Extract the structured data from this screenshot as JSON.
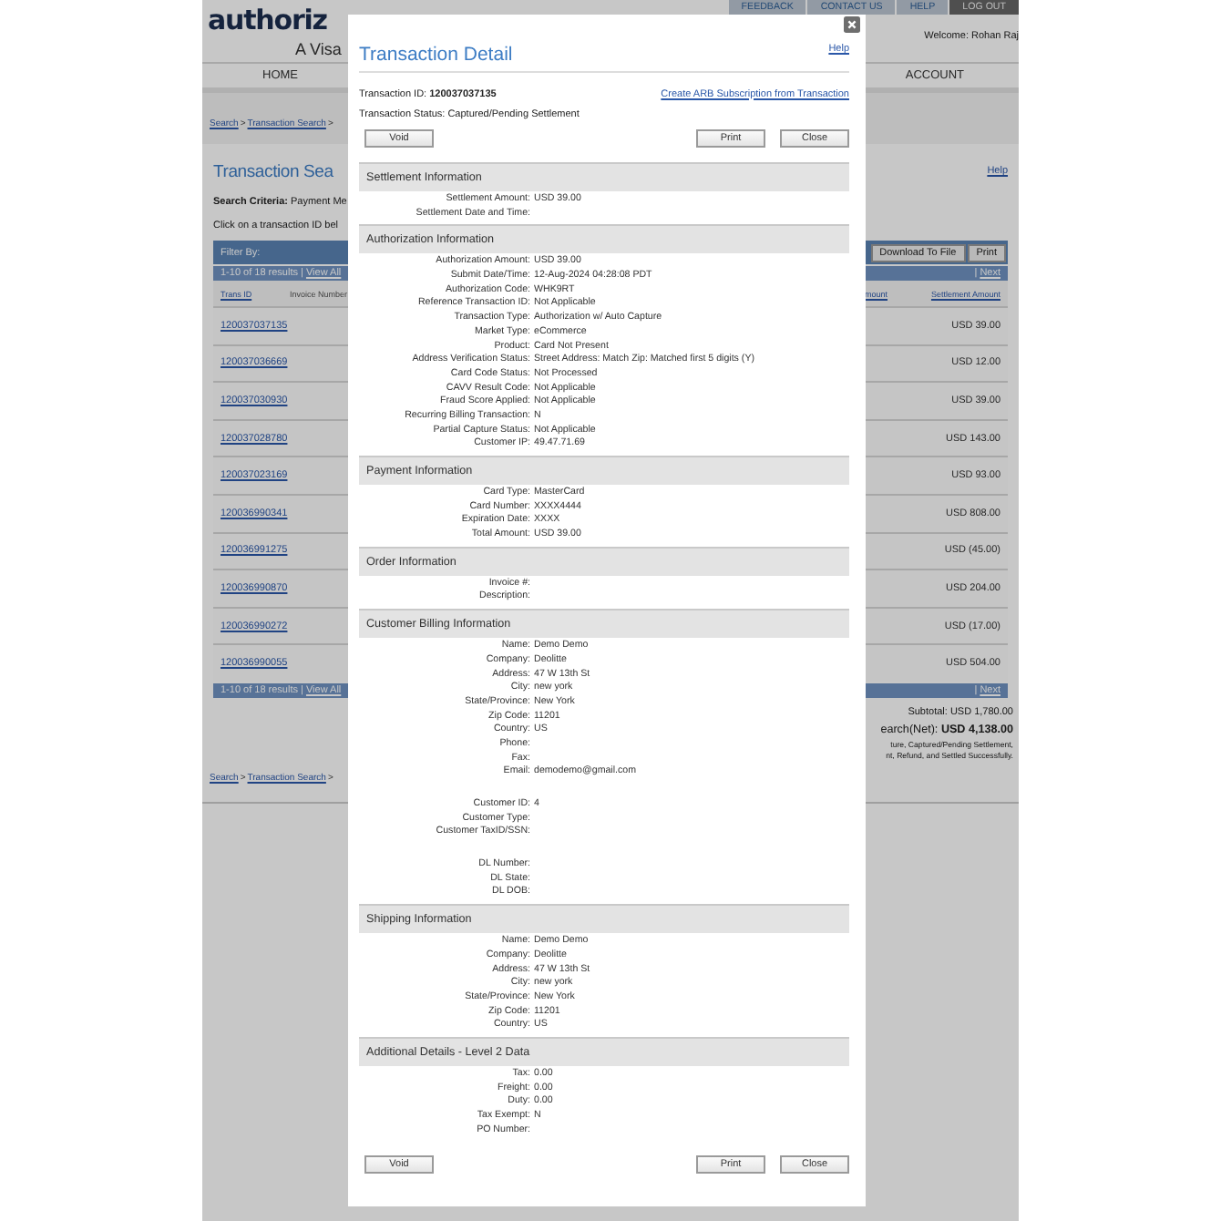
{
  "header": {
    "logo": "authoriz",
    "tagline": "A Visa",
    "top_links": [
      {
        "label": "FEEDBACK",
        "selected": false
      },
      {
        "label": "CONTACT US",
        "selected": false
      },
      {
        "label": "HELP",
        "selected": false
      },
      {
        "label": "LOG OUT",
        "selected": true
      }
    ],
    "welcome": "Welcome: Rohan Raj",
    "nav": [
      "HOME",
      "ACCOUNT"
    ]
  },
  "page": {
    "breadcrumb": [
      {
        "text": "Search",
        "kind": "link"
      },
      {
        "text": ">",
        "kind": "separator"
      },
      {
        "text": "Transaction Search",
        "kind": "link"
      },
      {
        "text": ">",
        "kind": "separator"
      }
    ],
    "title": "Transaction Sea",
    "help": "Help",
    "search_criteria": "**Search Criteria:** Payment Me",
    "instruction": "Click on a transaction ID bel",
    "filter_label": "Filter By:",
    "toolbar_buttons": [
      "Download To File",
      "Print"
    ],
    "pager": {
      "range": "1-10 of 18 results |",
      "view_all": "View All",
      "separator": "|",
      "next": "Next"
    },
    "columns": [
      "Trans ID",
      "Invoice Number",
      "mount",
      "Settlement Amount"
    ],
    "rows": [
      {
        "trans_id": "120037037135",
        "amount": "USD 39.00"
      },
      {
        "trans_id": "120037036669",
        "amount": "USD 12.00"
      },
      {
        "trans_id": "120037030930",
        "amount": "USD 39.00"
      },
      {
        "trans_id": "120037028780",
        "amount": "USD 143.00"
      },
      {
        "trans_id": "120037023169",
        "amount": "USD 93.00"
      },
      {
        "trans_id": "120036990341",
        "amount": "USD 808.00"
      },
      {
        "trans_id": "120036991275",
        "amount": "USD (45.00)"
      },
      {
        "trans_id": "120036990870",
        "amount": "USD 204.00"
      },
      {
        "trans_id": "120036990272",
        "amount": "USD (17.00)"
      },
      {
        "trans_id": "120036990055",
        "amount": "USD 504.00"
      }
    ],
    "pager_bottom": {
      "range": "1-10 of 18 results |",
      "view_all": "View All",
      "separator": "|",
      "next": "Next"
    },
    "subtotal": "Subtotal: USD 1,780.00",
    "net_total": "earch(Net): **USD 4,138.00**",
    "notes": [
      "ture, Captured/Pending Settlement,",
      "nt, Refund, and Settled Successfully."
    ],
    "breadcrumb_bottom": [
      {
        "text": "Search",
        "kind": "link"
      },
      {
        "text": ">",
        "kind": "separator"
      },
      {
        "text": "Transaction Search",
        "kind": "link"
      },
      {
        "text": ">",
        "kind": "separator"
      }
    ]
  },
  "modal": {
    "title": "Transaction Detail",
    "help": "Help",
    "transaction_id": "Transaction ID: **120037037135**",
    "arb_link": "Create ARB Subscription from Transaction",
    "status": "Transaction Status: Captured/Pending Settlement",
    "buttons_top": {
      "left": [
        "Void"
      ],
      "right": [
        "Print",
        "Close"
      ]
    },
    "buttons_bottom": {
      "left": [
        "Void"
      ],
      "right": [
        "Print",
        "Close"
      ]
    },
    "sections": [
      {
        "title": "Settlement Information",
        "groups": [
          [
            {
              "label": "Settlement Amount:",
              "value": "USD 39.00"
            },
            {
              "label": "Settlement Date and Time:"
            }
          ]
        ]
      },
      {
        "title": "Authorization Information",
        "groups": [
          [
            {
              "label": "Authorization Amount:",
              "value": "USD 39.00"
            },
            {
              "label": "Submit Date/Time:",
              "value": "12-Aug-2024 04:28:08 PDT"
            },
            {
              "label": "Authorization Code:",
              "value": "WHK9RT"
            },
            {
              "label": "Reference Transaction ID:",
              "value": "Not Applicable"
            },
            {
              "label": "Transaction Type:",
              "value": "Authorization w/ Auto Capture"
            },
            {
              "label": "Market Type:",
              "value": "eCommerce"
            },
            {
              "label": "Product:",
              "value": "Card Not Present"
            },
            {
              "label": "Address Verification Status:",
              "value": "Street Address: Match Zip: Matched first 5 digits (Y)"
            },
            {
              "label": "Card Code Status:",
              "value": "Not Processed"
            },
            {
              "label": "CAVV Result Code:",
              "value": "Not Applicable"
            },
            {
              "label": "Fraud Score Applied:",
              "value": "Not Applicable"
            },
            {
              "label": "Recurring Billing Transaction:",
              "value": "N"
            },
            {
              "label": "Partial Capture Status:",
              "value": "Not Applicable"
            },
            {
              "label": "Customer IP:",
              "value": "49.47.71.69"
            }
          ]
        ]
      },
      {
        "title": "Payment Information",
        "groups": [
          [
            {
              "label": "Card Type:",
              "value": "MasterCard"
            },
            {
              "label": "Card Number:",
              "value": "XXXX4444"
            },
            {
              "label": "Expiration Date:",
              "value": "XXXX"
            },
            {
              "label": "Total Amount:",
              "value": "USD 39.00"
            }
          ]
        ]
      },
      {
        "title": "Order Information",
        "groups": [
          [
            {
              "label": "Invoice #:"
            },
            {
              "label": "Description:"
            }
          ]
        ]
      },
      {
        "title": "Customer Billing Information",
        "groups": [
          [
            {
              "label": "Name:",
              "value": "Demo Demo"
            },
            {
              "label": "Company:",
              "value": "Deolitte"
            },
            {
              "label": "Address:",
              "value": "47 W 13th St"
            },
            {
              "label": "City:",
              "value": "new york"
            },
            {
              "label": "State/Province:",
              "value": "New York"
            },
            {
              "label": "Zip Code:",
              "value": "11201"
            },
            {
              "label": "Country:",
              "value": "US"
            },
            {
              "label": "Phone:"
            },
            {
              "label": "Fax:"
            },
            {
              "label": "Email:",
              "value": "demodemo@gmail.com"
            }
          ],
          [
            {
              "label": "Customer ID:",
              "value": "4"
            },
            {
              "label": "Customer Type:"
            },
            {
              "label": "Customer TaxID/SSN:"
            }
          ],
          [
            {
              "label": "DL Number:"
            },
            {
              "label": "DL State:"
            },
            {
              "label": "DL DOB:"
            }
          ]
        ]
      },
      {
        "title": "Shipping Information",
        "groups": [
          [
            {
              "label": "Name:",
              "value": "Demo Demo"
            },
            {
              "label": "Company:",
              "value": "Deolitte"
            },
            {
              "label": "Address:",
              "value": "47 W 13th St"
            },
            {
              "label": "City:",
              "value": "new york"
            },
            {
              "label": "State/Province:",
              "value": "New York"
            },
            {
              "label": "Zip Code:",
              "value": "11201"
            },
            {
              "label": "Country:",
              "value": "US"
            }
          ]
        ]
      },
      {
        "title": "Additional Details - Level 2 Data",
        "groups": [
          [
            {
              "label": "Tax:",
              "value": "0.00"
            },
            {
              "label": "Freight:",
              "value": "0.00"
            },
            {
              "label": "Duty:",
              "value": "0.00"
            },
            {
              "label": "Tax Exempt:",
              "value": "N"
            },
            {
              "label": "PO Number:"
            }
          ]
        ]
      }
    ]
  }
}
